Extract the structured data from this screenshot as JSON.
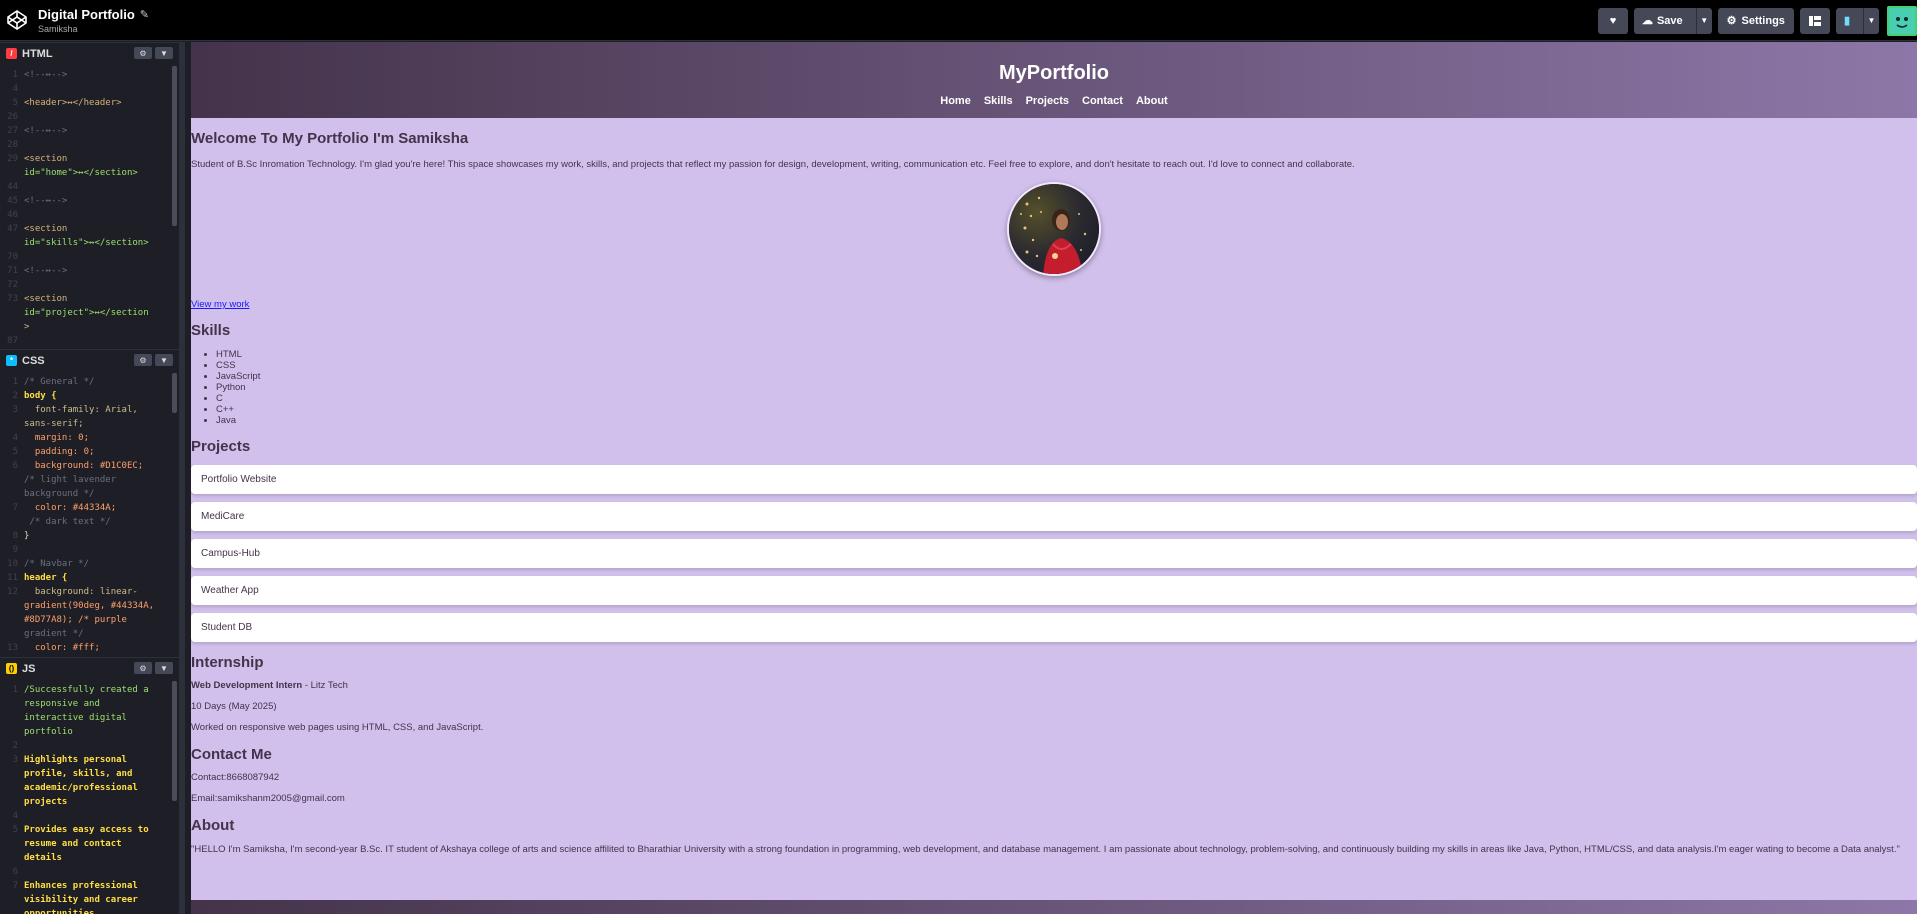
{
  "topbar": {
    "title": "Digital Portfolio",
    "user": "Samiksha",
    "save_label": "Save",
    "settings_label": "Settings"
  },
  "editor": {
    "html_label": "HTML",
    "css_label": "CSS",
    "js_label": "JS",
    "html_lines": [
      {
        "n": "1",
        "t": "<!--↔-->",
        "k": "com"
      },
      {
        "n": "4",
        "t": "",
        "k": ""
      },
      {
        "n": "5",
        "t": "<header>↔</header>",
        "k": "tag"
      },
      {
        "n": "26",
        "t": "",
        "k": ""
      },
      {
        "n": "27",
        "t": "<!--↔-->",
        "k": "com"
      },
      {
        "n": "28",
        "t": "",
        "k": ""
      },
      {
        "n": "29",
        "t": "<section",
        "k": "tag"
      },
      {
        "n": "",
        "t": "id=\"home\">↔</section>",
        "k": "str"
      },
      {
        "n": "44",
        "t": "",
        "k": ""
      },
      {
        "n": "45",
        "t": "<!--↔-->",
        "k": "com"
      },
      {
        "n": "46",
        "t": "",
        "k": ""
      },
      {
        "n": "47",
        "t": "<section",
        "k": "tag"
      },
      {
        "n": "",
        "t": "id=\"skills\">↔</section>",
        "k": "str"
      },
      {
        "n": "70",
        "t": "",
        "k": ""
      },
      {
        "n": "71",
        "t": "<!--↔-->",
        "k": "com"
      },
      {
        "n": "72",
        "t": "",
        "k": ""
      },
      {
        "n": "73",
        "t": "<section",
        "k": "tag"
      },
      {
        "n": "",
        "t": "id=\"project\">↔</section",
        "k": "str"
      },
      {
        "n": "",
        "t": ">",
        "k": "tag"
      },
      {
        "n": "87",
        "t": "",
        "k": ""
      }
    ],
    "css_lines": [
      {
        "n": "1",
        "t": "/* General */",
        "k": "com"
      },
      {
        "n": "2",
        "t": "body {",
        "k": "sel"
      },
      {
        "n": "3",
        "t": "  font-family: Arial,",
        "k": "prop"
      },
      {
        "n": "",
        "t": "sans-serif;",
        "k": "prop"
      },
      {
        "n": "4",
        "t": "  margin: 0;",
        "k": "val"
      },
      {
        "n": "5",
        "t": "  padding: 0;",
        "k": "val"
      },
      {
        "n": "6",
        "t": "  background: #D1C0EC;",
        "k": "val"
      },
      {
        "n": "",
        "t": "/* light lavender",
        "k": "com"
      },
      {
        "n": "",
        "t": "background */",
        "k": "com"
      },
      {
        "n": "7",
        "t": "  color: #44334A;",
        "k": "val"
      },
      {
        "n": "",
        "t": " /* dark text */",
        "k": "com"
      },
      {
        "n": "8",
        "t": "}",
        "k": ""
      },
      {
        "n": "9",
        "t": "",
        "k": ""
      },
      {
        "n": "10",
        "t": "/* Navbar */",
        "k": "com"
      },
      {
        "n": "11",
        "t": "header {",
        "k": "sel"
      },
      {
        "n": "12",
        "t": "  background: linear-",
        "k": "prop"
      },
      {
        "n": "",
        "t": "gradient(90deg, #44334A,",
        "k": "val"
      },
      {
        "n": "",
        "t": "#8D77A8); /* purple",
        "k": "val"
      },
      {
        "n": "",
        "t": "gradient */",
        "k": "com"
      },
      {
        "n": "13",
        "t": "  color: #fff;",
        "k": "val"
      }
    ],
    "js_lines": [
      {
        "n": "1",
        "t": "/Successfully created a",
        "k": "js"
      },
      {
        "n": "",
        "t": "responsive and",
        "k": "js"
      },
      {
        "n": "",
        "t": "interactive digital",
        "k": "js"
      },
      {
        "n": "",
        "t": "portfolio",
        "k": "js"
      },
      {
        "n": "2",
        "t": "",
        "k": ""
      },
      {
        "n": "3",
        "t": "Highlights personal",
        "k": "jsb"
      },
      {
        "n": "",
        "t": "profile, skills, and",
        "k": "jsb"
      },
      {
        "n": "",
        "t": "academic/professional",
        "k": "jsb"
      },
      {
        "n": "",
        "t": "projects",
        "k": "jsb"
      },
      {
        "n": "4",
        "t": "",
        "k": ""
      },
      {
        "n": "5",
        "t": "Provides easy access to",
        "k": "jsb"
      },
      {
        "n": "",
        "t": "resume and contact",
        "k": "jsb"
      },
      {
        "n": "",
        "t": "details",
        "k": "jsb"
      },
      {
        "n": "6",
        "t": "",
        "k": ""
      },
      {
        "n": "7",
        "t": "Enhances professional",
        "k": "jsb"
      },
      {
        "n": "",
        "t": "visibility and career",
        "k": "jsb"
      },
      {
        "n": "",
        "t": "opportunities",
        "k": "jsb"
      }
    ]
  },
  "preview": {
    "logo": "MyPortfolio",
    "nav": [
      "Home",
      "Skills",
      "Projects",
      "Contact",
      "About"
    ],
    "welcome_title": "Welcome To My Portfolio I'm Samiksha",
    "welcome_text": "Student of B.Sc Inromation Technology. I'm glad you're here! This space showcases my work, skills, and projects that reflect my passion for design, development, writing, communication etc. Feel free to explore, and don't hesitate to reach out. I'd love to connect and collaborate.",
    "view_work": "View my work",
    "skills_title": "Skills",
    "skills": [
      "HTML",
      "CSS",
      "JavaScript",
      "Python",
      "C",
      "C++",
      "Java"
    ],
    "projects_title": "Projects",
    "projects": [
      "Portfolio Website",
      "MediCare",
      "Campus-Hub",
      "Weather App",
      "Student DB"
    ],
    "internship_title": "Internship",
    "intern_role": "Web Development Intern",
    "intern_company": " - Litz Tech",
    "intern_duration": "10 Days (May 2025)",
    "intern_desc": "Worked on responsive web pages using HTML, CSS, and JavaScript.",
    "contact_title": "Contact Me",
    "contact_phone": "Contact:8668087942",
    "contact_email": "Email:samikshanm2005@gmail.com",
    "about_title": "About",
    "about_text": "\"HELLO I'm Samiksha, I'm second-year B.Sc. IT student of Akshaya college of arts and science affilited to Bharathiar University with a strong foundation in programming, web development, and database management. I am passionate about technology, problem-solving, and continuously building my skills in areas like Java, Python, HTML/CSS, and data analysis.I'm eager wating to become a Data analyst.\""
  },
  "colors": {
    "bg": "#D1C0EC",
    "text": "#44334A",
    "header_from": "#44334A",
    "header_to": "#8D77A8"
  }
}
